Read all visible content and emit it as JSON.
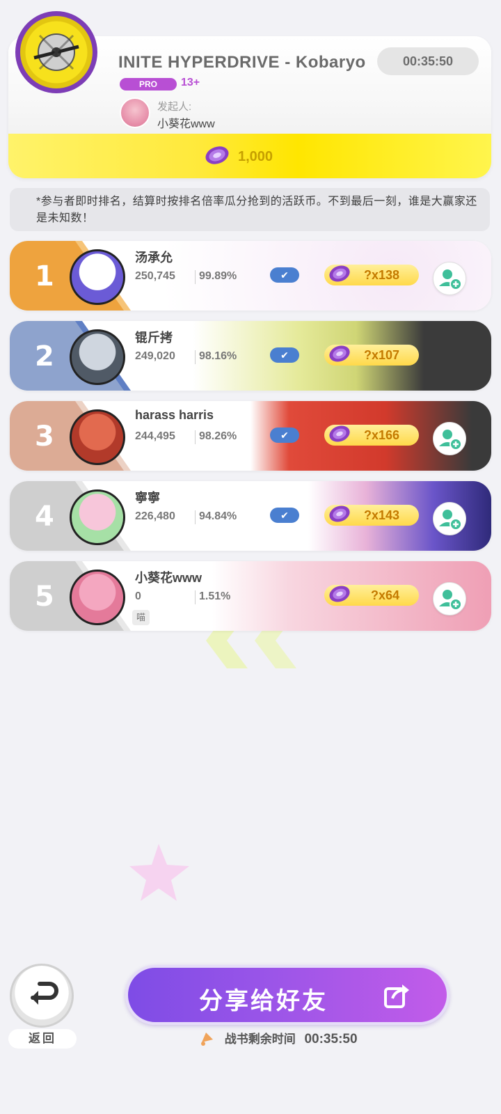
{
  "header": {
    "song_title": "INITE HYPERDRIVE - Kobaryo",
    "countdown": "00:35:50",
    "difficulty": "PRO",
    "level": "13+",
    "host_label": "发起人:",
    "host_name": "小葵花www",
    "prize": "1,000",
    "jacket_icon": "music-disc-icon"
  },
  "notice": "*参与者即时排名，结算时按排名倍率瓜分抢到的活跃币。不到最后一刻，谁是大赢家还是未知数！",
  "ranking": [
    {
      "rank": "1",
      "name": "汤承允",
      "score": "250,745",
      "accuracy": "99.89%",
      "reward": "?x138",
      "color": "#eea33e",
      "stripe": "#f6c478",
      "checked": true,
      "add_friend": true,
      "tag": ""
    },
    {
      "rank": "2",
      "name": "锟斤拷",
      "score": "249,020",
      "accuracy": "98.16%",
      "reward": "?x107",
      "color": "#8ea3cd",
      "stripe": "#5f7fc4",
      "checked": true,
      "add_friend": false,
      "tag": ""
    },
    {
      "rank": "3",
      "name": "harass harris",
      "score": "244,495",
      "accuracy": "98.26%",
      "reward": "?x166",
      "color": "#dcab95",
      "stripe": "#ecd2c5",
      "checked": true,
      "add_friend": true,
      "tag": ""
    },
    {
      "rank": "4",
      "name": "寧寧",
      "score": "226,480",
      "accuracy": "94.84%",
      "reward": "?x143",
      "color": "#cfcfcf",
      "stripe": "#e8e8e8",
      "checked": true,
      "add_friend": true,
      "tag": ""
    },
    {
      "rank": "5",
      "name": "小葵花www",
      "score": "0",
      "accuracy": "1.51%",
      "reward": "?x64",
      "color": "#cfcfcf",
      "stripe": "#e8e8e8",
      "checked": false,
      "add_friend": true,
      "tag": "喵"
    }
  ],
  "footer": {
    "back_label": "返回",
    "share_label": "分享给好友",
    "remain_label": "战书剩余时间",
    "remain_time": "00:35:50",
    "back_icon": "undo-arrow-icon",
    "share_icon": "share-icon",
    "remain_icon": "bell-icon"
  },
  "colors": {
    "accent_purple": "#9b55e8",
    "prize_yellow": "#ffe93a",
    "check_blue": "#4a7fd0",
    "friend_green": "#3fbf9a"
  }
}
